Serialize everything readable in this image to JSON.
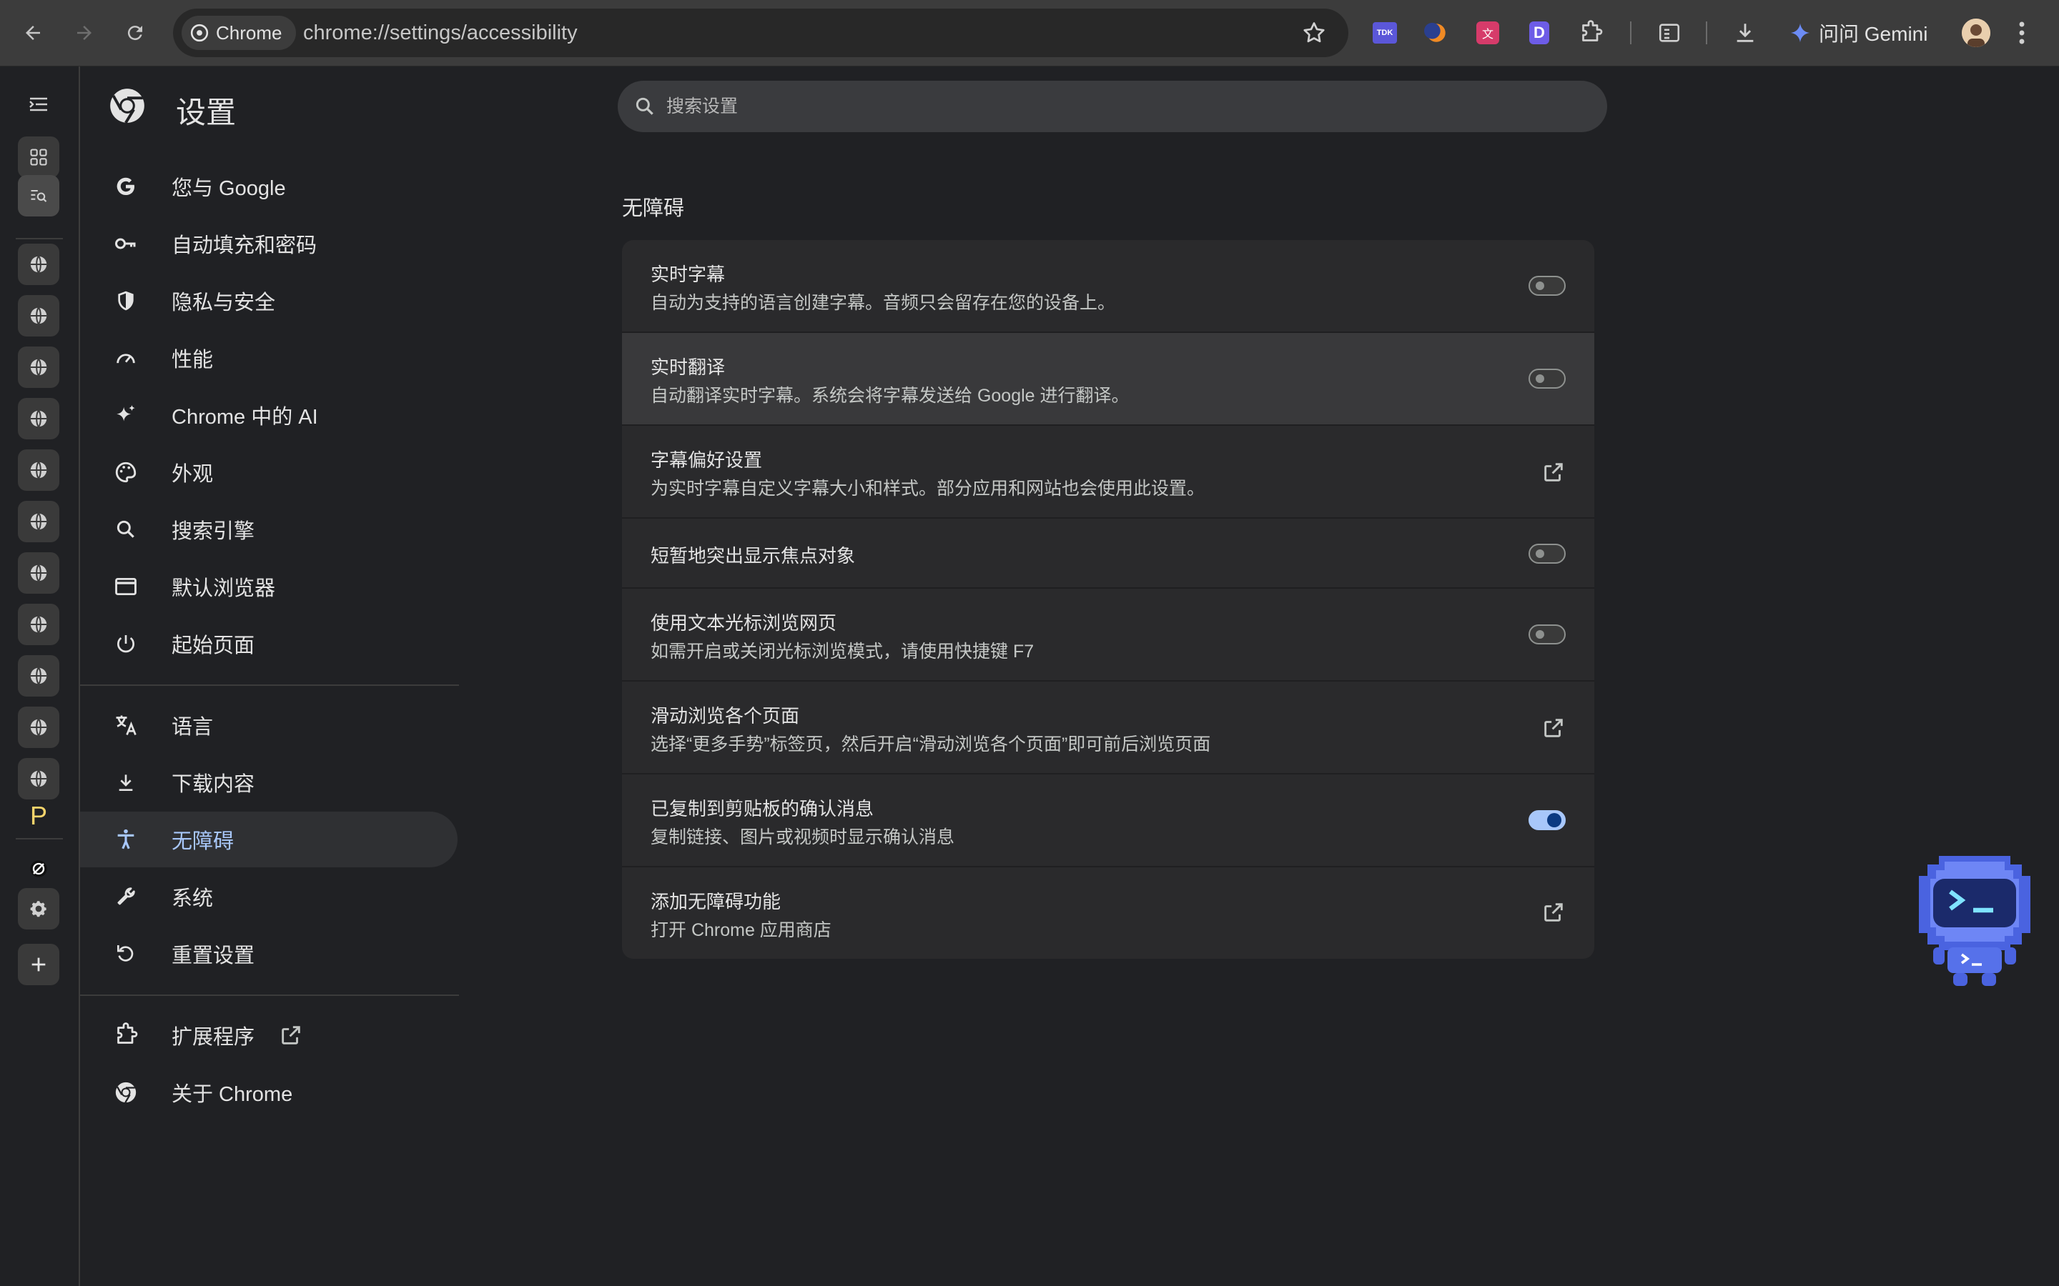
{
  "browser": {
    "chip_label": "Chrome",
    "url": "chrome://settings/accessibility",
    "gemini_label": "问问 Gemini"
  },
  "settings": {
    "title": "设置",
    "search_placeholder": "搜索设置",
    "nav": [
      {
        "label": "您与 Google",
        "icon": "google-g-icon"
      },
      {
        "label": "自动填充和密码",
        "icon": "key-icon"
      },
      {
        "label": "隐私与安全",
        "icon": "shield-icon"
      },
      {
        "label": "性能",
        "icon": "speedometer-icon"
      },
      {
        "label": "Chrome 中的 AI",
        "icon": "sparkle-icon"
      },
      {
        "label": "外观",
        "icon": "palette-icon"
      },
      {
        "label": "搜索引擎",
        "icon": "search-icon"
      },
      {
        "label": "默认浏览器",
        "icon": "browser-window-icon"
      },
      {
        "label": "起始页面",
        "icon": "power-icon"
      },
      {
        "label": "语言",
        "icon": "translate-icon"
      },
      {
        "label": "下载内容",
        "icon": "download-icon"
      },
      {
        "label": "无障碍",
        "icon": "accessibility-icon",
        "active": true
      },
      {
        "label": "系统",
        "icon": "wrench-icon"
      },
      {
        "label": "重置设置",
        "icon": "reset-icon"
      },
      {
        "label": "扩展程序",
        "icon": "extension-icon"
      },
      {
        "label": "关于 Chrome",
        "icon": "chrome-icon"
      }
    ]
  },
  "accessibility": {
    "section_title": "无障碍",
    "rows": [
      {
        "title": "实时字幕",
        "subtitle": "自动为支持的语言创建字幕。音频只会留存在您的设备上。",
        "control": "toggle",
        "on": false
      },
      {
        "title": "实时翻译",
        "subtitle": "自动翻译实时字幕。系统会将字幕发送给 Google 进行翻译。",
        "control": "toggle",
        "on": false
      },
      {
        "title": "字幕偏好设置",
        "subtitle": "为实时字幕自定义字幕大小和样式。部分应用和网站也会使用此设置。",
        "control": "external-link"
      },
      {
        "title": "短暂地突出显示焦点对象",
        "subtitle": "",
        "control": "toggle",
        "on": false
      },
      {
        "title": "使用文本光标浏览网页",
        "subtitle": "如需开启或关闭光标浏览模式，请使用快捷键 F7",
        "control": "toggle",
        "on": false
      },
      {
        "title": "滑动浏览各个页面",
        "subtitle": "选择“更多手势”标签页，然后开启“滑动浏览各个页面”即可前后浏览页面",
        "control": "external-link"
      },
      {
        "title": "已复制到剪贴板的确认消息",
        "subtitle": "复制链接、图片或视频时显示确认消息",
        "control": "toggle",
        "on": true
      },
      {
        "title": "添加无障碍功能",
        "subtitle": "打开 Chrome 应用商店",
        "control": "external-link"
      }
    ]
  },
  "vertical_tabs": {
    "pinned_letter": "P"
  },
  "colors": {
    "accent": "#a8c7fa",
    "background": "#202124",
    "card": "#2a2a2c"
  }
}
